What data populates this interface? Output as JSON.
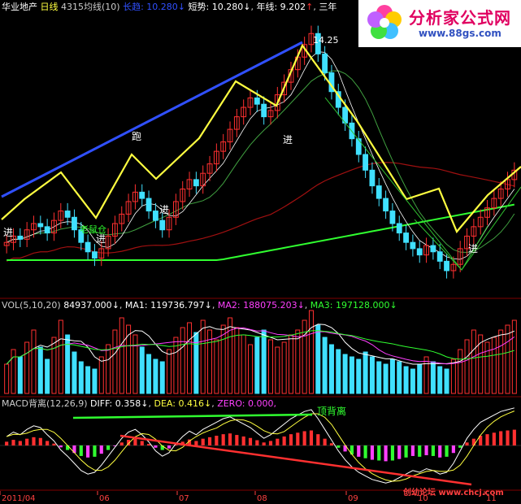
{
  "header": {
    "stock_name": "华业地产",
    "period": "日线",
    "indicator": "4315均线(10)",
    "trend_label": "长趋:",
    "trend_value": "10.280",
    "short_label": "短势:",
    "short_value": "10.280",
    "year_label": "年线:",
    "year_value": "9.202",
    "three_year_label": "三年"
  },
  "logo": {
    "brand": "分析家公式网",
    "url": "www.88gs.com"
  },
  "vol_header": {
    "name": "VOL(5,10,20)",
    "value": "84937.000",
    "ma1_label": "MA1:",
    "ma1_value": "119736.797",
    "ma2_label": "MA2:",
    "ma2_value": "188075.203",
    "ma3_label": "MA3:",
    "ma3_value": "197128.000"
  },
  "macd_header": {
    "name": "MACD背离(12,26,9)",
    "diff_label": "DIFF:",
    "diff_value": "0.358",
    "dea_label": "DEA:",
    "dea_value": "0.416",
    "zero_label": "ZERO:",
    "zero_value": "0.000,"
  },
  "annotations": {
    "peak": "14.25",
    "top_divergence": "顶背离",
    "enter1": "进",
    "enter2": "进",
    "enter3": "进",
    "enter4": "进",
    "enter5": "进",
    "run": "跑",
    "lao": "老鼠仓"
  },
  "axis_labels": [
    "2011/04",
    "06",
    "07",
    "08",
    "09",
    "10",
    "11"
  ],
  "watermark": "创幼论坛 www.chcj.com",
  "colors": {
    "bg": "#000000",
    "up": "#ff3030",
    "down": "#40e0ff",
    "yellow": "#ffff40",
    "blue": "#3050ff",
    "green": "#30ff30",
    "white": "#ffffff",
    "magenta": "#ff40ff",
    "darkred": "#a01010",
    "grid": "#800000"
  },
  "chart_data": {
    "type": "candlestick",
    "price": [
      7.6,
      7.8,
      7.7,
      8.0,
      8.2,
      8.1,
      7.9,
      8.3,
      8.6,
      8.4,
      8.0,
      7.6,
      7.3,
      7.1,
      7.4,
      7.8,
      8.2,
      8.5,
      8.9,
      9.2,
      9.0,
      8.6,
      8.3,
      8.0,
      8.4,
      8.9,
      9.3,
      9.6,
      9.4,
      9.8,
      10.1,
      10.5,
      10.8,
      11.2,
      11.6,
      11.9,
      12.2,
      12.0,
      11.6,
      11.8,
      12.3,
      12.7,
      13.1,
      13.5,
      13.9,
      14.25,
      13.6,
      13.0,
      12.4,
      11.9,
      11.4,
      10.9,
      10.4,
      9.9,
      9.4,
      9.0,
      8.6,
      8.2,
      7.9,
      7.6,
      7.4,
      7.2,
      7.5,
      7.3,
      7.0,
      6.7,
      6.9,
      7.4,
      7.8,
      8.1,
      8.4,
      8.7,
      9.0,
      9.3,
      9.6,
      9.9
    ],
    "volume": [
      120,
      180,
      150,
      210,
      260,
      190,
      140,
      230,
      300,
      240,
      170,
      130,
      110,
      100,
      150,
      200,
      260,
      310,
      280,
      240,
      190,
      160,
      140,
      130,
      180,
      230,
      270,
      290,
      250,
      300,
      260,
      220,
      280,
      310,
      270,
      240,
      200,
      230,
      260,
      220,
      190,
      210,
      240,
      260,
      300,
      340,
      280,
      230,
      200,
      180,
      160,
      150,
      140,
      170,
      150,
      130,
      120,
      140,
      130,
      110,
      100,
      120,
      150,
      130,
      110,
      100,
      140,
      180,
      220,
      260,
      240,
      210,
      230,
      260,
      280,
      300
    ],
    "macd": [
      0.1,
      0.15,
      0.12,
      0.18,
      0.22,
      0.2,
      0.12,
      0.05,
      -0.05,
      -0.12,
      -0.2,
      -0.28,
      -0.32,
      -0.3,
      -0.22,
      -0.12,
      -0.02,
      0.08,
      0.15,
      0.18,
      0.12,
      0.04,
      -0.06,
      -0.12,
      -0.08,
      0.02,
      0.1,
      0.16,
      0.12,
      0.18,
      0.22,
      0.26,
      0.3,
      0.32,
      0.28,
      0.24,
      0.2,
      0.14,
      0.08,
      0.12,
      0.18,
      0.24,
      0.3,
      0.34,
      0.38,
      0.4,
      0.3,
      0.18,
      0.06,
      -0.06,
      -0.16,
      -0.24,
      -0.3,
      -0.34,
      -0.38,
      -0.4,
      -0.42,
      -0.4,
      -0.36,
      -0.32,
      -0.28,
      -0.3,
      -0.26,
      -0.28,
      -0.32,
      -0.3,
      -0.2,
      -0.06,
      0.08,
      0.18,
      0.26,
      0.3,
      0.34,
      0.38,
      0.4,
      0.42
    ],
    "ylim": [
      6.0,
      14.8
    ]
  }
}
